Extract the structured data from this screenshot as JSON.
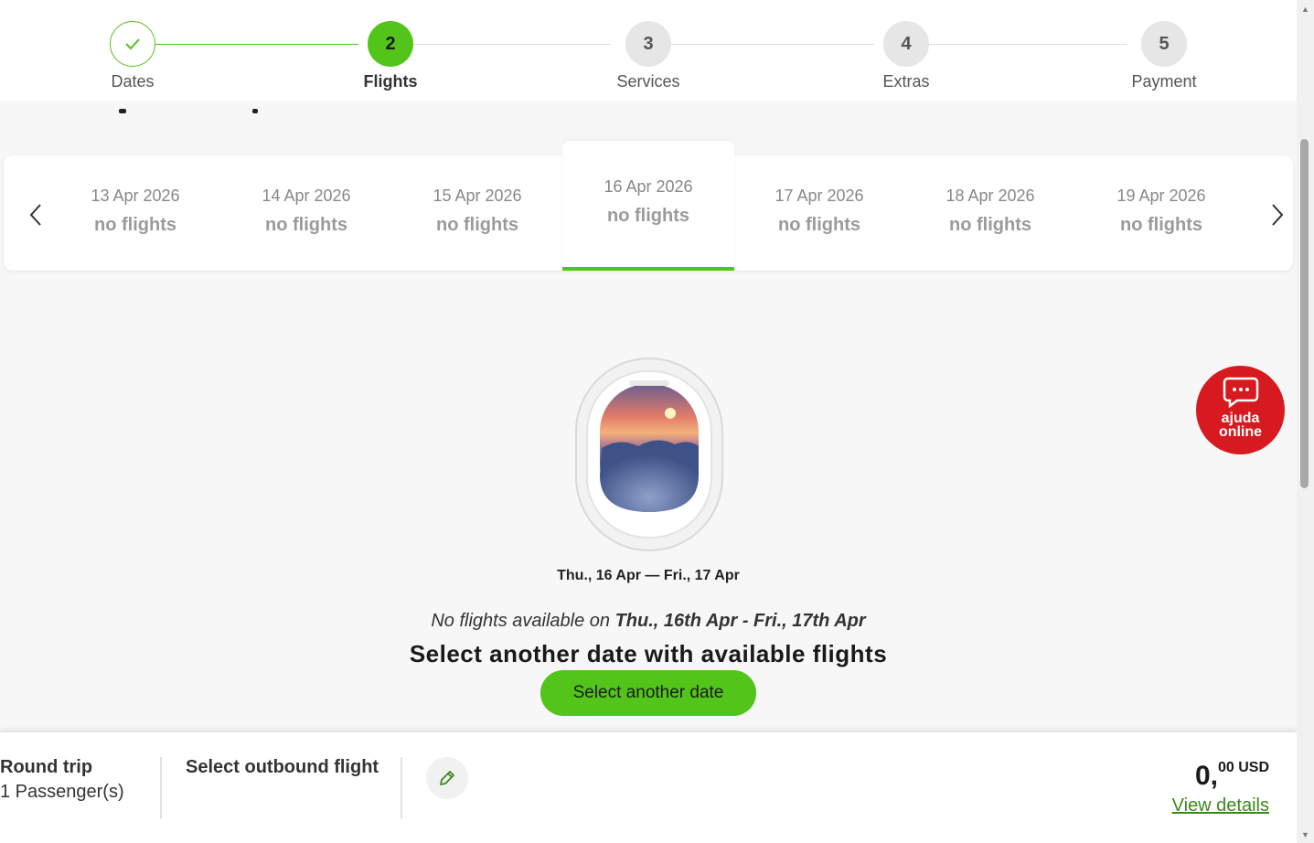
{
  "stepper": {
    "steps": [
      {
        "number": "",
        "label": "Dates"
      },
      {
        "number": "2",
        "label": "Flights"
      },
      {
        "number": "3",
        "label": "Services"
      },
      {
        "number": "4",
        "label": "Extras"
      },
      {
        "number": "5",
        "label": "Payment"
      }
    ],
    "current_step": 2
  },
  "dates": [
    {
      "date": "13 Apr 2026",
      "status": "no flights"
    },
    {
      "date": "14 Apr 2026",
      "status": "no flights"
    },
    {
      "date": "15 Apr 2026",
      "status": "no flights"
    },
    {
      "date": "16 Apr 2026",
      "status": "no flights"
    },
    {
      "date": "17 Apr 2026",
      "status": "no flights"
    },
    {
      "date": "18 Apr 2026",
      "status": "no flights"
    },
    {
      "date": "19 Apr 2026",
      "status": "no flights"
    }
  ],
  "empty_state": {
    "route_dates": "Thu., 16 Apr — Fri., 17 Apr",
    "no_flights_prefix": "No flights available on",
    "no_flights_dates": "Thu., 16th Apr - Fri., 17th Apr",
    "select_message": "Select another date with available flights",
    "select_button": "Select another date"
  },
  "chat": {
    "line1": "ajuda",
    "line2": "online",
    "color": "#d61a1f"
  },
  "summary": {
    "trip_type": "Round trip",
    "passengers": "1 Passenger(s)",
    "outbound": "Select outbound flight",
    "price_int": "0,",
    "price_dec": "00",
    "currency": "USD",
    "view_details": "View details"
  },
  "colors": {
    "accent": "#52c41a",
    "link": "#3a8a1a"
  }
}
